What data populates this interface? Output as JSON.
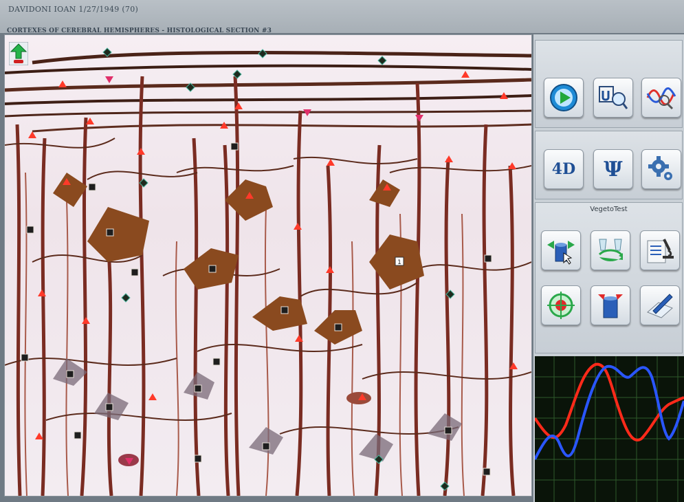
{
  "header": {
    "patient": "DAVIDONI IOAN    1/27/1949 (70)",
    "section_title": "CORTEXES OF CEREBRAL HEMISPHERES - HISTOLOGICAL SECTION #3"
  },
  "viewer": {
    "marker_label": "1"
  },
  "panel": {
    "top_buttons": [
      "play-icon",
      "search-zoom-icon",
      "wave-analysis-icon"
    ],
    "mid_buttons": [
      {
        "label": "4D",
        "icon": "4d-icon"
      },
      {
        "label": "Ψ",
        "icon": "psi-icon"
      },
      {
        "label": "",
        "icon": "gear-icon"
      }
    ],
    "vegeto": {
      "title": "VegetoTest",
      "buttons": [
        "cylinder-arrows-icon",
        "cups-arrows-icon",
        "microscope-icon",
        "target-icon",
        "cylinder-icon",
        "pen-paper-icon"
      ]
    }
  },
  "colors": {
    "scope_background": "#0a1409",
    "trace_red": "#ff2a1a",
    "trace_blue": "#2a56ff",
    "accent_blue": "#1f4f95"
  }
}
